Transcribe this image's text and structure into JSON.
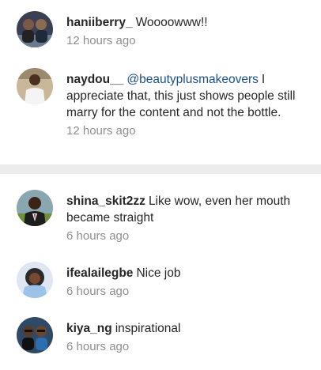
{
  "comments": [
    {
      "username": "haniiberry_",
      "text": "Woooowww!!",
      "time": "12 hours ago"
    },
    {
      "username": "naydou__",
      "mention": "@beautyplusmakeovers",
      "text": "I appreciate that, this just shows people still marry for the content and not the  bottle.",
      "time": "12 hours ago"
    },
    {
      "username": "shina_skit2zz",
      "text": "Like wow, even her mouth became straight",
      "time": "6 hours ago"
    },
    {
      "username": "ifealailegbe",
      "text": "Nice job",
      "time": "6 hours ago"
    },
    {
      "username": "kiya_ng",
      "text": "inspirational",
      "time": "6 hours ago"
    }
  ]
}
